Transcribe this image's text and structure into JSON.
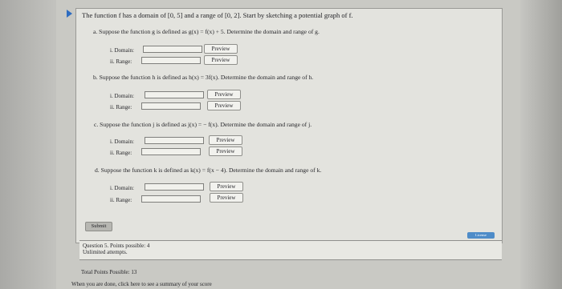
{
  "question": {
    "intro": "The function f has a domain of [0, 5] and a range of [0, 2]. Start by sketching a potential graph of f."
  },
  "parts": [
    {
      "label": "a. Suppose the function g is defined as g(x) = f(x) + 5. Determine the domain and range of g.",
      "domain_label": "i. Domain:",
      "range_label": "ii. Range:",
      "domain_value": "",
      "range_value": "",
      "preview": "Preview"
    },
    {
      "label": "b. Suppose the function h is defined as h(x) = 3f(x). Determine the domain and range of h.",
      "domain_label": "i. Domain:",
      "range_label": "ii. Range:",
      "domain_value": "",
      "range_value": "",
      "preview": "Preview"
    },
    {
      "label": "c. Suppose the function j is defined as j(x) = − f(x). Determine the domain and range of j.",
      "domain_label": "i. Domain:",
      "range_label": "ii. Range:",
      "domain_value": "",
      "range_value": "",
      "preview": "Preview"
    },
    {
      "label": "d. Suppose the function k is defined as k(x) = f(x − 4). Determine the domain and range of k.",
      "domain_label": "i. Domain:",
      "range_label": "ii. Range:",
      "domain_value": "",
      "range_value": "",
      "preview": "Preview"
    }
  ],
  "submit": "Submit",
  "license_badge": "License",
  "question_info": {
    "points": "Question 5. Points possible: 4",
    "attempts": "Unlimited attempts."
  },
  "footer": {
    "total_points": "Total Points Possible: 13",
    "done_link": "When you are done, click here to see a summary of your score"
  },
  "colors": {
    "accent": "#2d6cc0",
    "page_bg": "#c9c9c4",
    "card_bg": "#e3e3de"
  },
  "icons": {
    "question_marker": "triangle-right-icon"
  }
}
